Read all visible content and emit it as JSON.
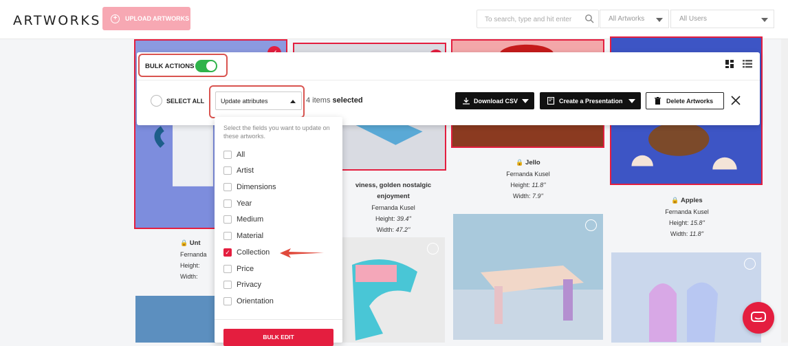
{
  "header": {
    "brand": "ARTWORKS",
    "upload_label": "UPLOAD ARTWORKS",
    "search_placeholder": "To search, type and hit enter",
    "filter_artworks": "All Artworks",
    "filter_users": "All Users"
  },
  "bulk_bar": {
    "label": "BULK ACTIONS",
    "toggle_on": true,
    "select_all": "SELECT ALL",
    "attribute_select": "Update attributes",
    "count_text": "4 items",
    "selected_word": "selected",
    "download_csv": "Download CSV",
    "create_presentation": "Create a Presentation",
    "delete_artworks": "Delete Artworks"
  },
  "dropdown": {
    "help_text": "Select the fields you want to update on these artworks.",
    "options": [
      {
        "label": "All",
        "checked": false
      },
      {
        "label": "Artist",
        "checked": false
      },
      {
        "label": "Dimensions",
        "checked": false
      },
      {
        "label": "Year",
        "checked": false
      },
      {
        "label": "Medium",
        "checked": false
      },
      {
        "label": "Material",
        "checked": false
      },
      {
        "label": "Collection",
        "checked": true
      },
      {
        "label": "Price",
        "checked": false
      },
      {
        "label": "Privacy",
        "checked": false
      },
      {
        "label": "Orientation",
        "checked": false
      }
    ],
    "bulk_edit": "BULK EDIT"
  },
  "artworks": [
    {
      "title": "Unt",
      "artist": "Fernanda",
      "height_label": "Height:",
      "width_label": "Width:",
      "height": "",
      "width": ""
    },
    {
      "title": "viness, golden nostalgic enjoyment",
      "artist": "Fernanda Kusel",
      "height_label": "Height:",
      "width_label": "Width:",
      "height": "39.4''",
      "width": "47.2''"
    },
    {
      "title": "Jello",
      "artist": "Fernanda Kusel",
      "height_label": "Height:",
      "width_label": "Width:",
      "height": "11.8''",
      "width": "7.9''"
    },
    {
      "title": "Apples",
      "artist": "Fernanda Kusel",
      "height_label": "Height:",
      "width_label": "Width:",
      "height": "15.8''",
      "width": "11.8''"
    }
  ],
  "colors": {
    "accent": "#e41e3f",
    "toggle": "#2fb34a",
    "highlight": "#d9534f"
  }
}
